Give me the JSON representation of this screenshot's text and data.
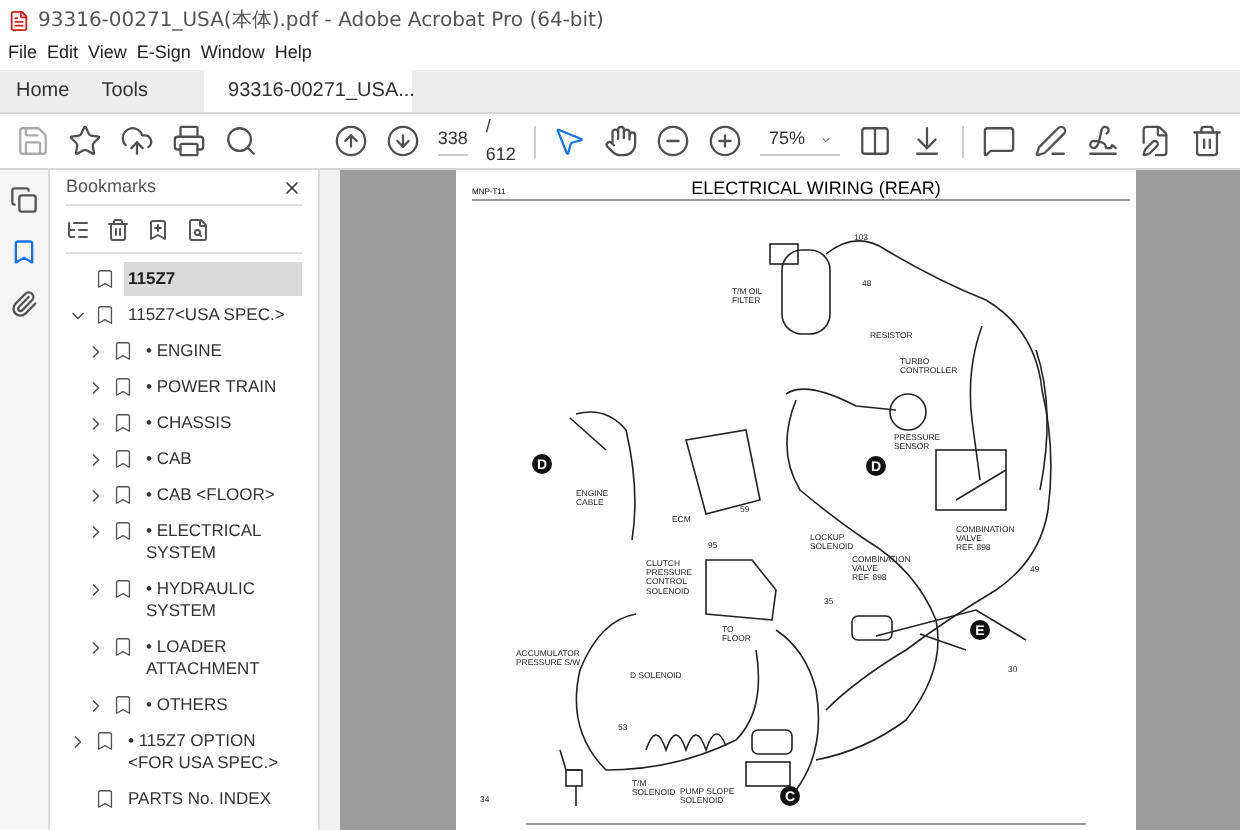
{
  "window": {
    "title": "93316-00271_USA(本体).pdf - Adobe Acrobat Pro (64-bit)"
  },
  "menu": [
    "File",
    "Edit",
    "View",
    "E-Sign",
    "Window",
    "Help"
  ],
  "tabs": [
    {
      "label": "Home",
      "selected": false
    },
    {
      "label": "Tools",
      "selected": false
    },
    {
      "label": "93316-00271_USA...",
      "selected": true
    }
  ],
  "toolbar": {
    "page": "338",
    "page_count": "/ 612",
    "zoom": "75%"
  },
  "side_rail": [
    {
      "kind": "pages",
      "selected": false
    },
    {
      "kind": "bookmarks",
      "selected": true
    },
    {
      "kind": "attachments",
      "selected": false
    }
  ],
  "bookmarks": {
    "title": "Bookmarks",
    "items": [
      {
        "label": "115Z7",
        "selected": true
      },
      {
        "label": "115Z7<USA SPEC.>",
        "selected": false,
        "expanded": true,
        "children": [
          {
            "label": "• ENGINE",
            "selected": false,
            "expanded": false
          },
          {
            "label": "• POWER TRAIN",
            "selected": false,
            "expanded": false
          },
          {
            "label": "• CHASSIS",
            "selected": false,
            "expanded": false
          },
          {
            "label": "• CAB",
            "selected": false,
            "expanded": false
          },
          {
            "label": "• CAB <FLOOR>",
            "selected": false,
            "expanded": false
          },
          {
            "label": "• ELECTRICAL SYSTEM",
            "selected": false,
            "expanded": false
          },
          {
            "label": "• HYDRAULIC SYSTEM",
            "selected": false,
            "expanded": false
          },
          {
            "label": "• LOADER ATTACHMENT",
            "selected": false,
            "expanded": false
          },
          {
            "label": "• OTHERS",
            "selected": false,
            "expanded": false
          }
        ]
      },
      {
        "label": "• 115Z7 OPTION <FOR USA SPEC.>",
        "selected": false,
        "expanded": false
      },
      {
        "label": "PARTS No. INDEX",
        "selected": false
      }
    ]
  },
  "document": {
    "code": "MNP-T11",
    "title": "ELECTRICAL WIRING (REAR)",
    "labels": [
      {
        "kind": "callout",
        "lines": [
          "T/M OIL",
          "FILTER"
        ]
      },
      {
        "kind": "callout",
        "lines": [
          "RESISTOR"
        ]
      },
      {
        "kind": "callout",
        "lines": [
          "TURBO",
          "CONTROLLER"
        ]
      },
      {
        "kind": "callout",
        "lines": [
          "PRESSURE",
          "SENSOR"
        ]
      },
      {
        "kind": "callout",
        "lines": [
          "ENGINE",
          "CABLE"
        ]
      },
      {
        "kind": "callout",
        "lines": [
          "ECM"
        ]
      },
      {
        "kind": "callout",
        "lines": [
          "LOCKUP",
          "SOLENOID"
        ]
      },
      {
        "kind": "callout",
        "lines": [
          "COMBINATION",
          "VALVE",
          "REF. 898"
        ]
      },
      {
        "kind": "callout",
        "lines": [
          "CLUTCH",
          "PRESSURE",
          "CONTROL",
          "SOLENOID"
        ]
      },
      {
        "kind": "callout",
        "lines": [
          "COMBINATION",
          "VALVE",
          "REF. 898"
        ]
      },
      {
        "kind": "callout",
        "lines": [
          "TO",
          "FLOOR"
        ]
      },
      {
        "kind": "callout",
        "lines": [
          "ACCUMULATOR",
          "PRESSURE S/W"
        ]
      },
      {
        "kind": "callout",
        "lines": [
          "D SOLENOID"
        ]
      },
      {
        "kind": "callout",
        "lines": [
          "T/M",
          "SOLENOID"
        ]
      },
      {
        "kind": "callout",
        "lines": [
          "PUMP SLOPE",
          "SOLENOID"
        ]
      },
      {
        "kind": "marker",
        "lines": [
          "D"
        ]
      },
      {
        "kind": "marker",
        "lines": [
          "D"
        ]
      },
      {
        "kind": "marker",
        "lines": [
          "E"
        ]
      },
      {
        "kind": "marker",
        "lines": [
          "C"
        ]
      },
      {
        "kind": "number",
        "lines": [
          "103"
        ]
      },
      {
        "kind": "number",
        "lines": [
          "48"
        ]
      },
      {
        "kind": "number",
        "lines": [
          "59"
        ]
      },
      {
        "kind": "number",
        "lines": [
          "95"
        ]
      },
      {
        "kind": "number",
        "lines": [
          "35"
        ]
      },
      {
        "kind": "number",
        "lines": [
          "49"
        ]
      },
      {
        "kind": "number",
        "lines": [
          "30"
        ]
      },
      {
        "kind": "number",
        "lines": [
          "34"
        ]
      },
      {
        "kind": "number",
        "lines": [
          "53"
        ]
      }
    ]
  }
}
